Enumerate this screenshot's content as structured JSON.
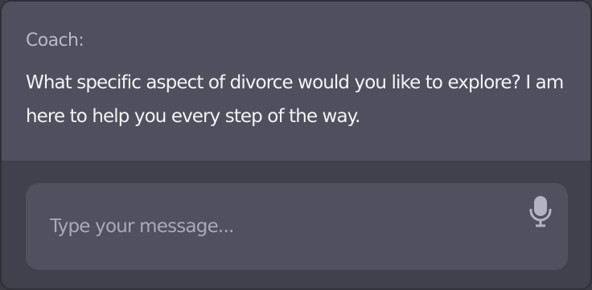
{
  "message": {
    "speaker": "Coach:",
    "text": "What specific aspect of divorce would you like to explore? I am here to help you every step of the way."
  },
  "input": {
    "placeholder": "Type your message...",
    "value": ""
  },
  "icons": {
    "mic": "microphone-icon"
  },
  "colors": {
    "message_bg": "#4f4f5d",
    "page_bg": "#41414d",
    "input_bg": "#50505e",
    "text": "#f3f3f7",
    "muted_text": "#b8b9c6",
    "icon": "#b3b4c1"
  }
}
